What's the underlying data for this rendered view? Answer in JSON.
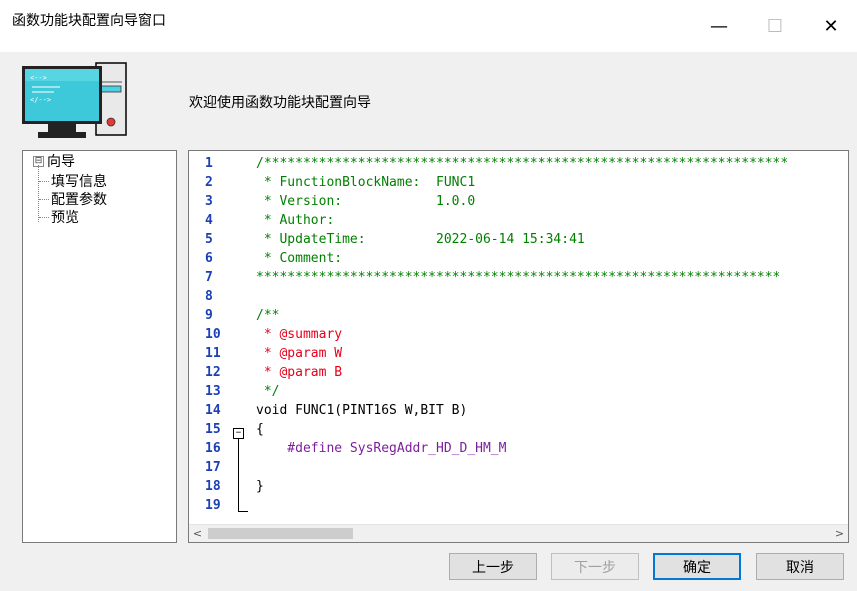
{
  "window": {
    "title": "函数功能块配置向导窗口",
    "minimize": "—",
    "maximize": "☐",
    "close": "✕"
  },
  "header": {
    "welcome": "欢迎使用函数功能块配置向导",
    "icon": "computer-code-icon"
  },
  "tree": {
    "toggle": "⊟",
    "root": "向导",
    "children": [
      "填写信息",
      "配置参数",
      "预览"
    ]
  },
  "code": {
    "lines": [
      {
        "n": "1",
        "text": "/*******************************************************************",
        "color": "green"
      },
      {
        "n": "2",
        "text": " * FunctionBlockName:  FUNC1",
        "color": "green"
      },
      {
        "n": "3",
        "text": " * Version:            1.0.0",
        "color": "green"
      },
      {
        "n": "4",
        "text": " * Author:",
        "color": "green"
      },
      {
        "n": "5",
        "text": " * UpdateTime:         2022-06-14 15:34:41",
        "color": "green"
      },
      {
        "n": "6",
        "text": " * Comment:",
        "color": "green"
      },
      {
        "n": "7",
        "text": "*******************************************************************",
        "color": "green"
      },
      {
        "n": "8",
        "text": "",
        "color": "green"
      },
      {
        "n": "9",
        "text": "/**",
        "color": "green"
      },
      {
        "n": "10",
        "text": " * @summary",
        "color": "red"
      },
      {
        "n": "11",
        "text": " * @param W",
        "color": "red"
      },
      {
        "n": "12",
        "text": " * @param B",
        "color": "red"
      },
      {
        "n": "13",
        "text": " */",
        "color": "green"
      },
      {
        "n": "14",
        "text": "void FUNC1(PINT16S W,BIT B)",
        "color": "black"
      },
      {
        "n": "15",
        "text": "{",
        "color": "black"
      },
      {
        "n": "16",
        "text": "    #define SysRegAddr_HD_D_HM_M",
        "color": "purple"
      },
      {
        "n": "17",
        "text": "",
        "color": "black"
      },
      {
        "n": "18",
        "text": "}",
        "color": "black"
      },
      {
        "n": "19",
        "text": "",
        "color": "black"
      }
    ],
    "fold_marker": "−"
  },
  "scroll": {
    "left": "<",
    "right": ">"
  },
  "buttons": {
    "prev": "上一步",
    "next": "下一步",
    "ok": "确定",
    "cancel": "取消"
  }
}
